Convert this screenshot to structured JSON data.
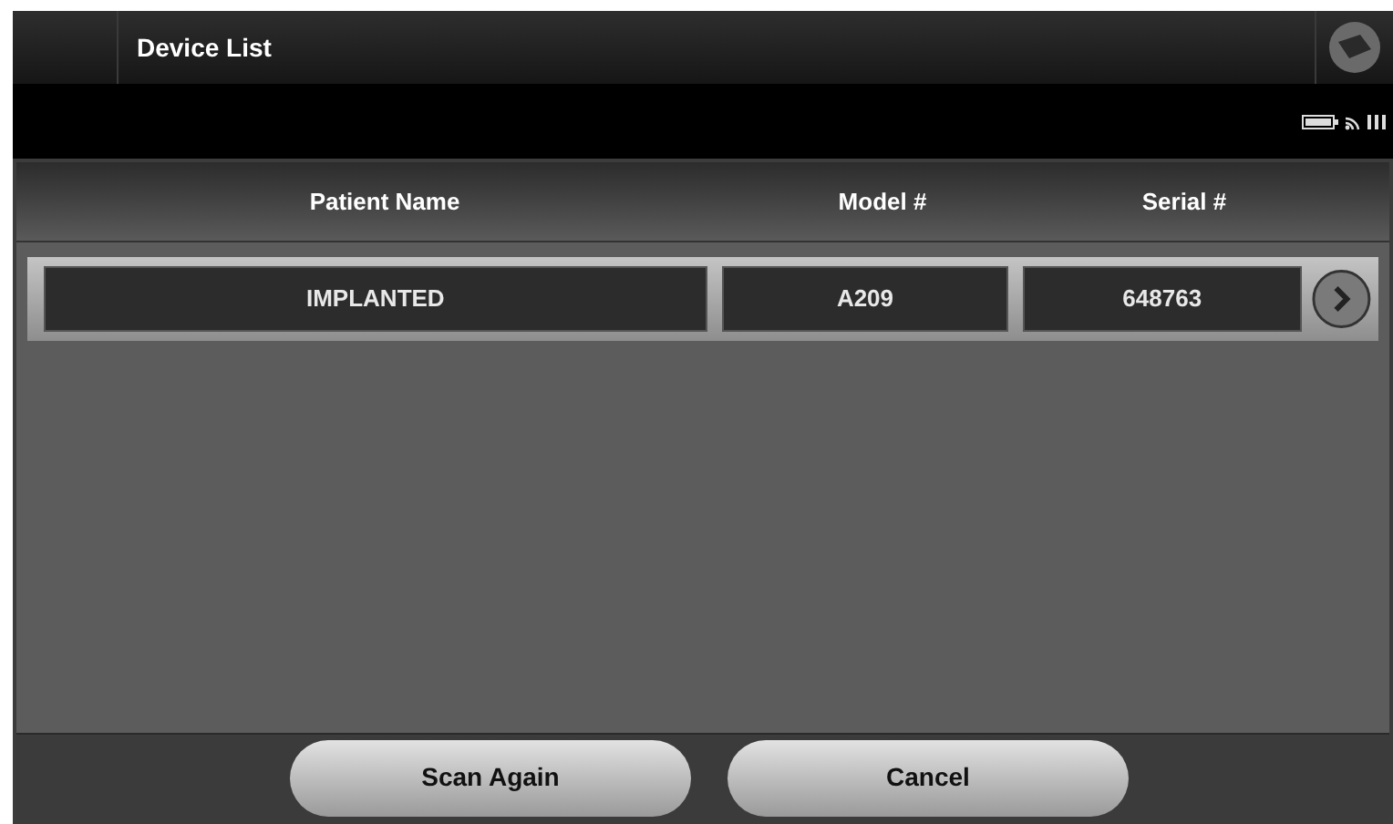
{
  "title_bar": {
    "title": "Device List"
  },
  "table": {
    "columns": [
      "Patient Name",
      "Model #",
      "Serial #"
    ],
    "rows": [
      {
        "cells": [
          "IMPLANTED",
          "A209",
          "648763"
        ]
      }
    ]
  },
  "buttons": [
    "Scan Again",
    "Cancel"
  ]
}
